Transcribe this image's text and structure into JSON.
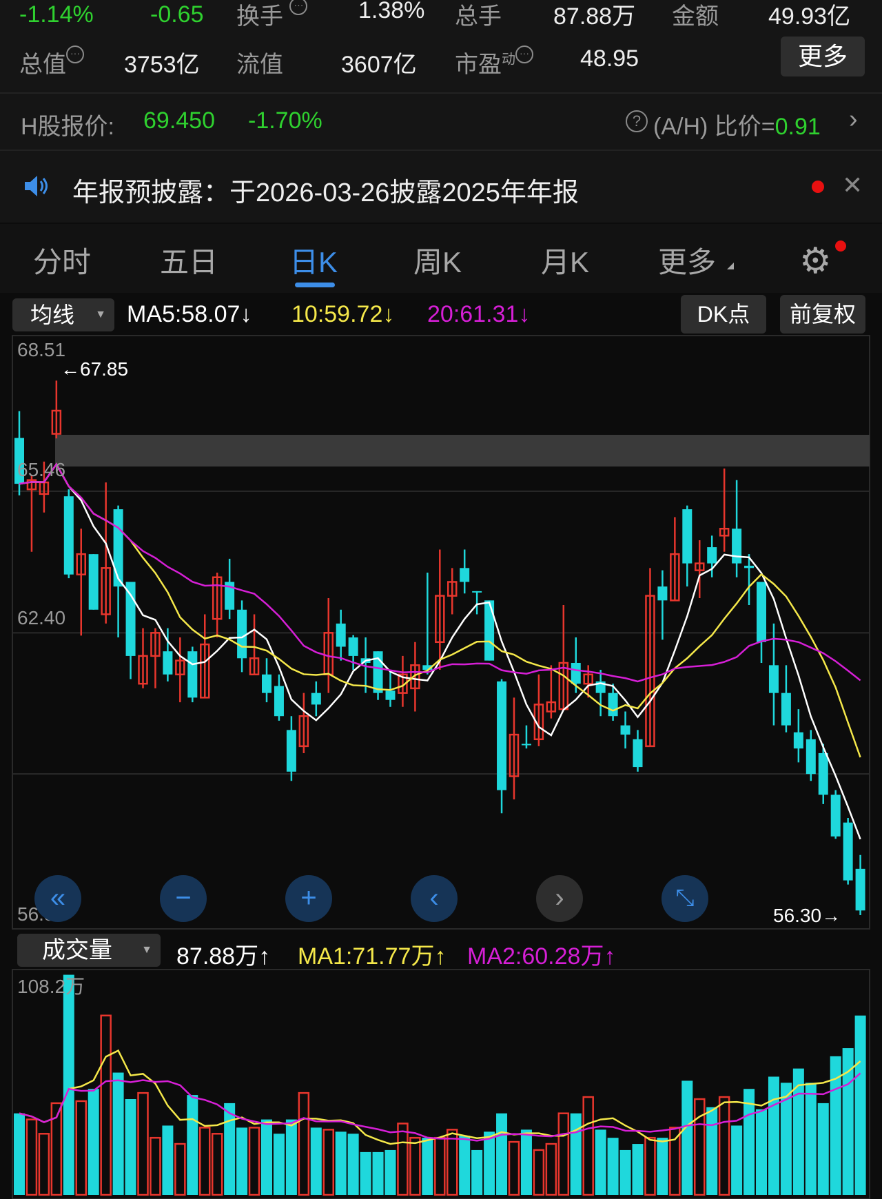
{
  "stats": {
    "change_pct": "-1.14%",
    "change": "-0.65",
    "turnover_label": "换手",
    "turnover": "1.38%",
    "volume_label": "总手",
    "volume": "87.88万",
    "amount_label": "金额",
    "amount": "49.93亿",
    "mktcap_label": "总值",
    "mktcap": "3753亿",
    "float_label": "流值",
    "float": "3607亿",
    "pe_label": "市盈",
    "pe_sup": "动",
    "pe": "48.95",
    "more_label": "更多"
  },
  "hshare": {
    "label": "H股报价:",
    "price": "69.450",
    "change": "-1.70%",
    "ah_label": "(A/H) 比价=",
    "ah_value": "0.91"
  },
  "notice": {
    "text": "年报预披露：于2026-03-26披露2025年年报"
  },
  "tabs": [
    {
      "label": "分时"
    },
    {
      "label": "五日"
    },
    {
      "label": "日K"
    },
    {
      "label": "周K"
    },
    {
      "label": "月K"
    },
    {
      "label": "更多"
    }
  ],
  "chart_toolbar": {
    "indicator": "均线",
    "ma5": "MA5:58.07↓",
    "ma10": "10:59.72↓",
    "ma20": "20:61.31↓",
    "dk_label": "DK点",
    "adjust_label": "前复权"
  },
  "volume_toolbar": {
    "indicator": "成交量",
    "vol": "87.88万↑",
    "ma1": "MA1:71.77万↑",
    "ma2": "MA2:60.28万↑"
  },
  "colors": {
    "up": "#e8362d",
    "down": "#1fd8dc",
    "ma5": "#ffffff",
    "ma10": "#f5e84a",
    "ma20": "#d61fd6",
    "green": "#2fd12f",
    "accent": "#3d8ee8"
  },
  "chart_data": {
    "type": "candlestick",
    "y_labels": [
      "68.51",
      "65.46",
      "62.40",
      "56.30"
    ],
    "ylim": [
      56.3,
      68.51
    ],
    "max_label": "←67.85",
    "min_label": "56.30→",
    "ohlc": [
      [
        66.61,
        65.62,
        67.19,
        65.37
      ],
      [
        65.5,
        65.7,
        65.8,
        64.15
      ],
      [
        65.4,
        65.65,
        66.1,
        65.0
      ],
      [
        66.7,
        67.2,
        67.85,
        66.6
      ],
      [
        65.35,
        63.66,
        65.5,
        63.58
      ],
      [
        63.66,
        64.1,
        64.65,
        62.34
      ],
      [
        64.1,
        62.9,
        64.1,
        62.9
      ],
      [
        62.8,
        63.8,
        65.65,
        62.6
      ],
      [
        65.07,
        63.4,
        65.15,
        62.3
      ],
      [
        63.5,
        61.9,
        63.5,
        61.4
      ],
      [
        61.3,
        61.9,
        62.5,
        61.2
      ],
      [
        61.9,
        62.4,
        62.5,
        61.2
      ],
      [
        62.0,
        61.5,
        62.5,
        61.35
      ],
      [
        61.5,
        61.8,
        62.3,
        60.9
      ],
      [
        62.0,
        61.0,
        62.1,
        60.9
      ],
      [
        61.0,
        62.15,
        62.8,
        61.0
      ],
      [
        62.7,
        63.6,
        63.7,
        62.3
      ],
      [
        63.5,
        62.9,
        64.0,
        62.7
      ],
      [
        62.9,
        61.85,
        63.1,
        61.55
      ],
      [
        61.5,
        61.85,
        62.8,
        61.5
      ],
      [
        61.5,
        61.1,
        61.85,
        60.9
      ],
      [
        61.25,
        60.6,
        61.5,
        60.5
      ],
      [
        60.3,
        59.4,
        60.6,
        59.2
      ],
      [
        59.95,
        60.6,
        61.1,
        59.8
      ],
      [
        61.1,
        60.85,
        61.35,
        60.6
      ],
      [
        61.5,
        62.4,
        63.15,
        61.1
      ],
      [
        62.6,
        62.1,
        62.9,
        61.8
      ],
      [
        62.3,
        61.9,
        62.35,
        61.6
      ],
      [
        61.85,
        61.75,
        62.3,
        61.1
      ],
      [
        62.0,
        61.1,
        62.0,
        60.95
      ],
      [
        61.15,
        60.95,
        61.6,
        60.8
      ],
      [
        61.1,
        61.5,
        61.9,
        60.8
      ],
      [
        61.2,
        61.7,
        62.2,
        60.7
      ],
      [
        61.7,
        61.6,
        63.7,
        61.5
      ],
      [
        62.2,
        63.2,
        64.2,
        61.6
      ],
      [
        63.2,
        63.5,
        63.8,
        62.8
      ],
      [
        63.8,
        63.5,
        64.2,
        63.25
      ],
      [
        63.3,
        63.28,
        63.3,
        62.8
      ],
      [
        63.1,
        61.8,
        63.1,
        61.8
      ],
      [
        61.35,
        59.0,
        61.4,
        58.5
      ],
      [
        59.3,
        60.2,
        61.0,
        58.8
      ],
      [
        60.0,
        59.98,
        60.4,
        59.9
      ],
      [
        60.1,
        60.85,
        61.5,
        59.95
      ],
      [
        60.7,
        60.9,
        61.7,
        60.55
      ],
      [
        60.75,
        61.75,
        63.0,
        60.75
      ],
      [
        61.75,
        61.3,
        62.3,
        61.1
      ],
      [
        61.3,
        61.5,
        61.7,
        61.0
      ],
      [
        61.35,
        61.1,
        61.6,
        60.6
      ],
      [
        61.1,
        60.6,
        61.3,
        60.5
      ],
      [
        60.4,
        60.2,
        60.7,
        59.9
      ],
      [
        60.1,
        59.5,
        60.3,
        59.4
      ],
      [
        59.95,
        63.2,
        63.8,
        59.95
      ],
      [
        63.4,
        63.1,
        63.75,
        62.25
      ],
      [
        63.1,
        64.1,
        64.9,
        63.1
      ],
      [
        65.07,
        63.9,
        65.15,
        63.4
      ],
      [
        63.75,
        63.9,
        64.4,
        63.15
      ],
      [
        64.25,
        63.9,
        64.5,
        63.6
      ],
      [
        64.5,
        64.65,
        65.95,
        64.15
      ],
      [
        64.65,
        63.9,
        65.7,
        63.6
      ],
      [
        63.85,
        63.8,
        64.1,
        63.0
      ],
      [
        63.5,
        62.2,
        63.5,
        61.75
      ],
      [
        61.7,
        61.1,
        62.6,
        60.4
      ],
      [
        61.1,
        60.4,
        61.7,
        60.25
      ],
      [
        60.25,
        59.9,
        60.75,
        59.6
      ],
      [
        60.1,
        59.35,
        60.3,
        59.2
      ],
      [
        59.8,
        58.9,
        60.0,
        58.7
      ],
      [
        58.9,
        58.0,
        59.0,
        57.95
      ],
      [
        58.3,
        57.05,
        58.4,
        56.96
      ],
      [
        57.3,
        56.4,
        57.6,
        56.3
      ]
    ],
    "volume_max_label": "108.2万",
    "volume_max": 108.2,
    "volume": [
      40,
      37,
      30,
      45,
      108,
      46,
      52,
      88,
      60,
      47,
      50,
      28,
      34,
      25,
      49,
      33,
      30,
      45,
      33,
      33,
      37,
      30,
      37,
      50,
      33,
      32,
      31,
      30,
      21,
      21,
      22,
      35,
      28,
      28,
      28,
      32,
      29,
      22,
      31,
      40,
      26,
      32,
      22,
      25,
      40,
      40,
      48,
      32,
      28,
      22,
      25,
      28,
      28,
      33,
      56,
      47,
      43,
      48,
      34,
      52,
      42,
      58,
      55,
      62,
      55,
      45,
      68,
      72,
      88
    ]
  }
}
